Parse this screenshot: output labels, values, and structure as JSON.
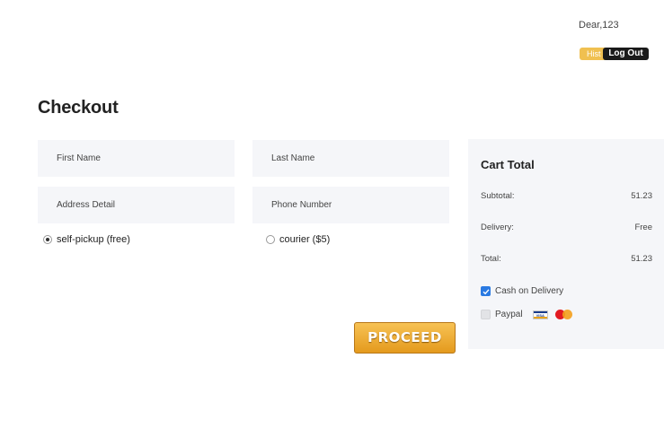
{
  "header": {
    "greeting": "Dear,123",
    "history_label": "Hist",
    "logout_label": "Log Out"
  },
  "page": {
    "title": "Checkout"
  },
  "form": {
    "first_name": {
      "placeholder": "First Name",
      "value": ""
    },
    "last_name": {
      "placeholder": "Last Name",
      "value": ""
    },
    "address": {
      "placeholder": "Address Detail",
      "value": ""
    },
    "phone": {
      "placeholder": "Phone Number",
      "value": ""
    },
    "delivery_options": [
      {
        "label": "self-pickup (free)",
        "selected": true
      },
      {
        "label": "courier ($5)",
        "selected": false
      }
    ],
    "proceed_label": "PROCEED"
  },
  "cart": {
    "title": "Cart Total",
    "subtotal": {
      "label": "Subtotal:",
      "value": "51.23"
    },
    "delivery": {
      "label": "Delivery:",
      "value": "Free"
    },
    "total": {
      "label": "Total:",
      "value": "51.23"
    },
    "payment": [
      {
        "label": "Cash on Delivery",
        "checked": true
      },
      {
        "label": "Paypal",
        "checked": false,
        "icons": [
          "visa-card-icon",
          "mastercard-icon"
        ]
      }
    ]
  },
  "colors": {
    "accent": "#2a7ae2",
    "proceed": "#f0a82c",
    "hist_badge": "#f0c050",
    "panel_bg": "#f5f6f9"
  }
}
